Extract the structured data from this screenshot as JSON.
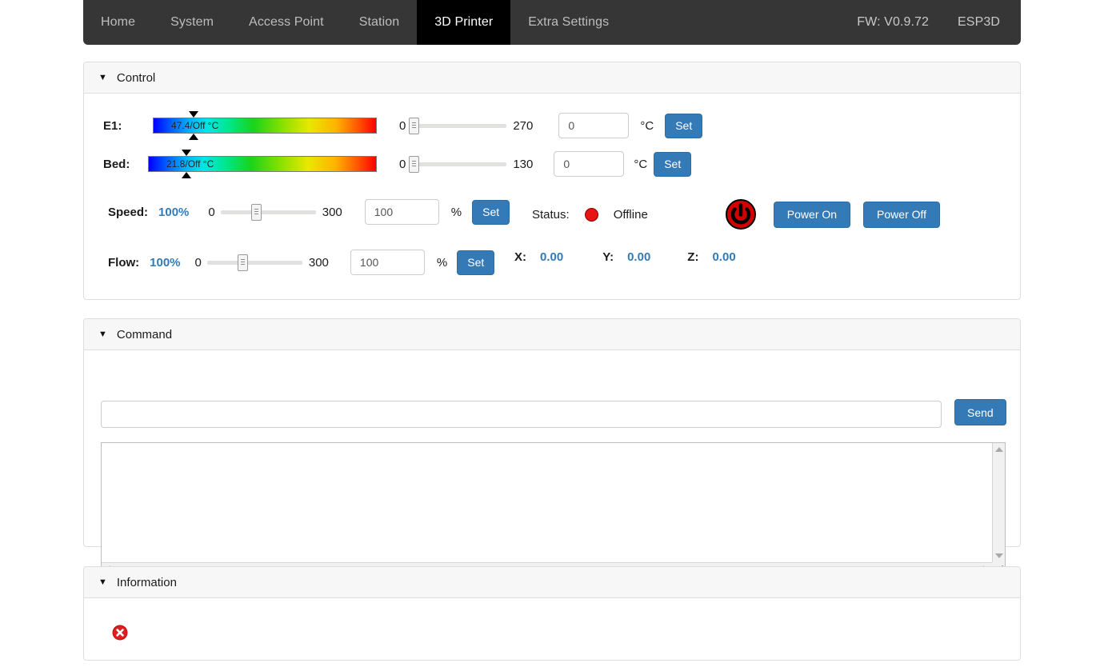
{
  "navbar": {
    "items": [
      {
        "label": "Home",
        "active": false
      },
      {
        "label": "System",
        "active": false
      },
      {
        "label": "Access Point",
        "active": false
      },
      {
        "label": "Station",
        "active": false
      },
      {
        "label": "3D Printer",
        "active": true
      },
      {
        "label": "Extra Settings",
        "active": false
      }
    ],
    "firmware": "FW: V0.9.72",
    "brand": "ESP3D",
    "active_bg": "#000000",
    "bg": "#363636"
  },
  "panels": {
    "control": {
      "title": "Control",
      "caret": "▼"
    },
    "command": {
      "title": "Command",
      "caret": "▼"
    },
    "information": {
      "title": "Information",
      "caret": "▼"
    }
  },
  "control": {
    "extruder": {
      "label": "E1:",
      "temp_text": "47.4/Off °C",
      "current": 47.4,
      "target": "Off",
      "slider": {
        "min": "0",
        "max": "270",
        "value": 0
      },
      "input_value": "0",
      "unit": "°C",
      "set_label": "Set"
    },
    "bed": {
      "label": "Bed:",
      "temp_text": "21.8/Off °C",
      "current": 21.8,
      "target": "Off",
      "slider": {
        "min": "0",
        "max": "130",
        "value": 0
      },
      "input_value": "0",
      "unit": "°C",
      "set_label": "Set"
    },
    "speed": {
      "label": "Speed:",
      "value_text": "100%",
      "slider": {
        "min": "0",
        "max": "300",
        "value": 100
      },
      "input_value": "100",
      "unit": "%",
      "set_label": "Set"
    },
    "flow": {
      "label": "Flow:",
      "value_text": "100%",
      "slider": {
        "min": "0",
        "max": "300",
        "value": 100
      },
      "input_value": "100",
      "unit": "%",
      "set_label": "Set"
    },
    "status": {
      "label": "Status:",
      "state": "Offline",
      "indicator_color": "#e81313"
    },
    "power": {
      "icon": "power-icon",
      "on_label": "Power On",
      "off_label": "Power Off",
      "icon_color": "#d40000"
    },
    "position": {
      "x_label": "X:",
      "x_value": "0.00",
      "y_label": "Y:",
      "y_value": "0.00",
      "z_label": "Z:",
      "z_value": "0.00"
    }
  },
  "command": {
    "input_value": "",
    "input_placeholder": "",
    "send_label": "Send",
    "console_text": ""
  },
  "information": {
    "status_icon": "error-circle-icon",
    "message": ""
  },
  "theme": {
    "accent": "#337ab7",
    "accent_border": "#2e6da4",
    "link_blue": "#337ab7",
    "panel_head_bg": "#f7f7f7",
    "panel_border": "#dddddd"
  }
}
